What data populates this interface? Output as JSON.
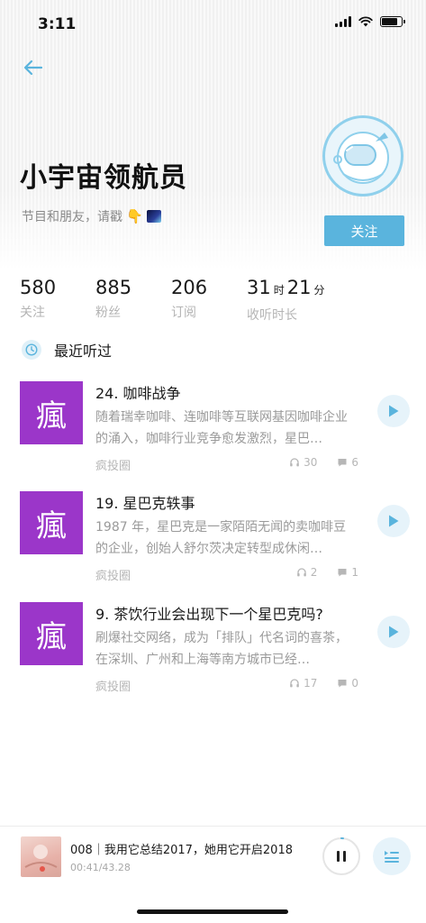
{
  "status_bar": {
    "time": "3:11"
  },
  "profile": {
    "name": "小宇宙领航员",
    "bio": "节目和朋友，请戳",
    "bio_emoji": "👇",
    "follow_label": "关注"
  },
  "stats": [
    {
      "value": "580",
      "label": "关注"
    },
    {
      "value": "885",
      "label": "粉丝"
    },
    {
      "value": "206",
      "label": "订阅"
    },
    {
      "hours": "31",
      "hours_unit": "时",
      "minutes": "21",
      "minutes_unit": "分",
      "label": "收听时长"
    }
  ],
  "recent": {
    "title": "最近听过",
    "episodes": [
      {
        "cover_char": "瘋",
        "title": "24. 咖啡战争",
        "desc": "随着瑞幸咖啡、连咖啡等互联网基因咖啡企业的涌入，咖啡行业竞争愈发激烈，星巴…",
        "source": "疯投圈",
        "listens": "30",
        "comments": "6"
      },
      {
        "cover_char": "瘋",
        "title": "19. 星巴克轶事",
        "desc": "1987 年，星巴克是一家陌陌无闻的卖咖啡豆的企业，创始人舒尔茨决定转型成休闲…",
        "source": "疯投圈",
        "listens": "2",
        "comments": "1"
      },
      {
        "cover_char": "瘋",
        "title": "9. 茶饮行业会出现下一个星巴克吗?",
        "desc": "刷爆社交网络，成为「排队」代名词的喜茶，在深圳、广州和上海等南方城市已经…",
        "source": "疯投圈",
        "listens": "17",
        "comments": "0"
      }
    ]
  },
  "player": {
    "title": "008｜我用它总结2017，她用它开启2018",
    "time": "00:41/43.28",
    "progress": 0.016
  },
  "colors": {
    "accent": "#5ab4dd",
    "cover_purple": "#9b36c9",
    "play_bg": "#e6f3fa"
  }
}
